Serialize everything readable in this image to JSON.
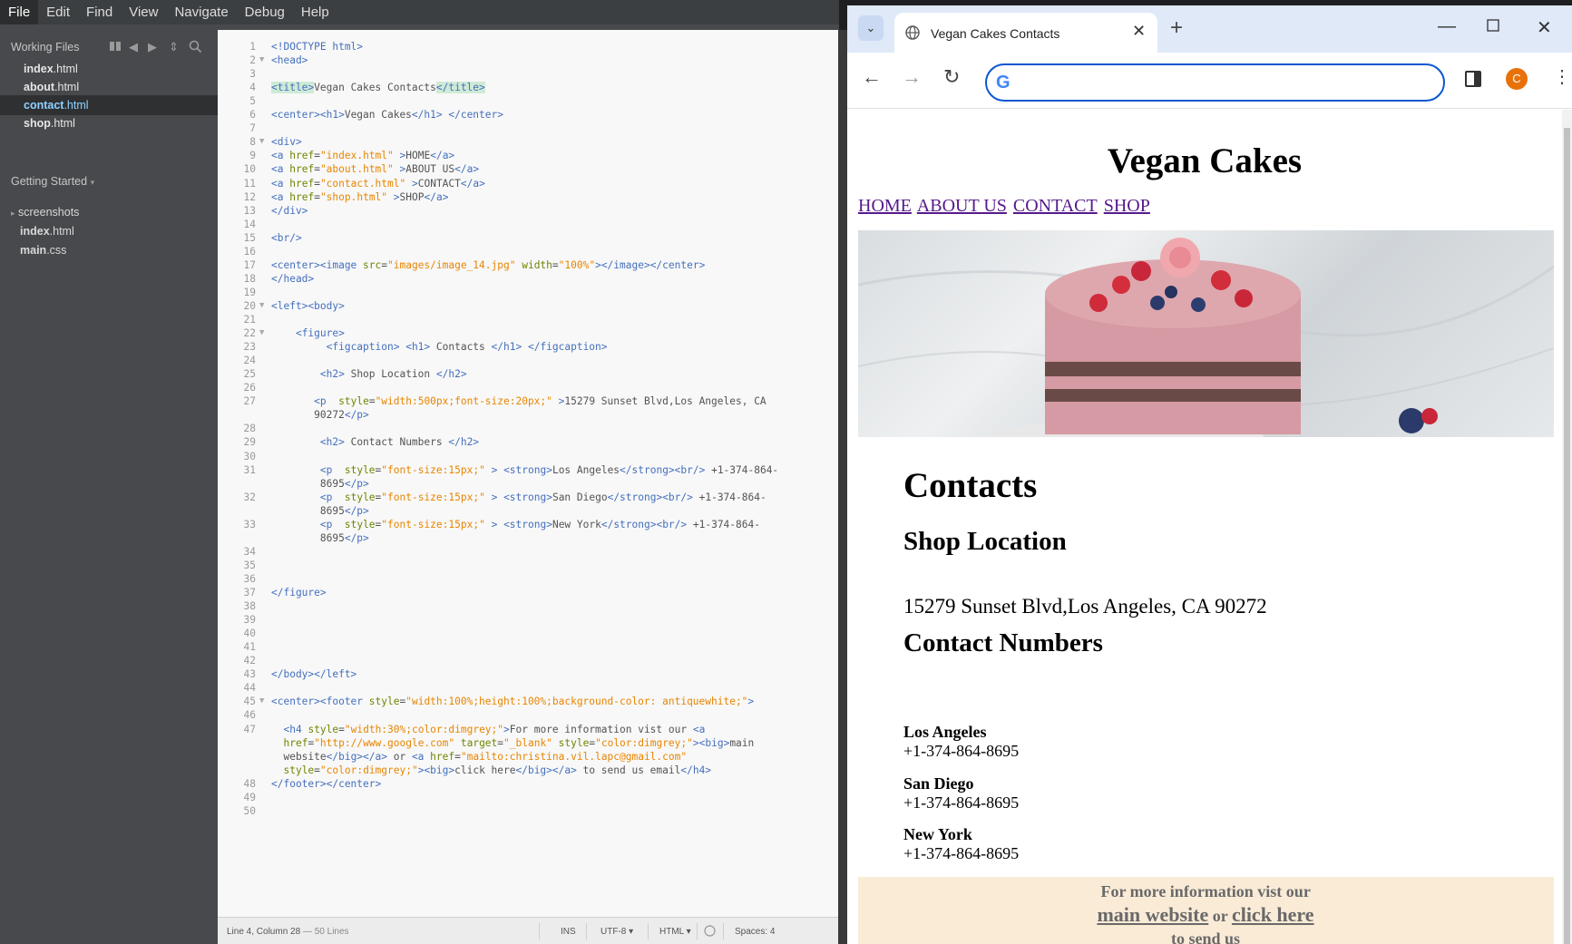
{
  "menubar": [
    "File",
    "Edit",
    "Find",
    "View",
    "Navigate",
    "Debug",
    "Help"
  ],
  "sidebar": {
    "working_files_title": "Working Files",
    "working_files": [
      {
        "name": "index",
        "ext": ".html"
      },
      {
        "name": "about",
        "ext": ".html"
      },
      {
        "name": "contact",
        "ext": ".html"
      },
      {
        "name": "shop",
        "ext": ".html"
      }
    ],
    "getting_started": "Getting Started",
    "tree": [
      {
        "label": "screenshots",
        "type": "folder"
      },
      {
        "name": "index",
        "ext": ".html",
        "type": "file"
      },
      {
        "name": "main",
        "ext": ".css",
        "type": "file"
      }
    ]
  },
  "code_lines": [
    {
      "n": "1",
      "html": "<span class=\"t\">&lt;!DOCTYPE html&gt;</span>"
    },
    {
      "n": "2",
      "fold": true,
      "html": "<span class=\"t\">&lt;head&gt;</span>"
    },
    {
      "n": "3",
      "html": ""
    },
    {
      "n": "4",
      "html": "<span class=\"t hl\">&lt;title&gt;</span>Vegan Cakes Contacts<span class=\"t hl\">&lt;/title&gt;</span>"
    },
    {
      "n": "5",
      "html": ""
    },
    {
      "n": "6",
      "html": "<span class=\"t\">&lt;center&gt;&lt;h1&gt;</span>Vegan Cakes<span class=\"t\">&lt;/h1&gt;</span> <span class=\"t\">&lt;/center&gt;</span>"
    },
    {
      "n": "7",
      "html": ""
    },
    {
      "n": "8",
      "fold": true,
      "html": "<span class=\"t\">&lt;div&gt;</span>"
    },
    {
      "n": "9",
      "html": "<span class=\"t\">&lt;a</span> <span class=\"a\">href</span>=<span class=\"s\">\"index.html\"</span> <span class=\"t\">&gt;</span>HOME<span class=\"t\">&lt;/a&gt;</span>"
    },
    {
      "n": "10",
      "html": "<span class=\"t\">&lt;a</span> <span class=\"a\">href</span>=<span class=\"s\">\"about.html\"</span> <span class=\"t\">&gt;</span>ABOUT US<span class=\"t\">&lt;/a&gt;</span>"
    },
    {
      "n": "11",
      "html": "<span class=\"t\">&lt;a</span> <span class=\"a\">href</span>=<span class=\"s\">\"contact.html\"</span> <span class=\"t\">&gt;</span>CONTACT<span class=\"t\">&lt;/a&gt;</span>"
    },
    {
      "n": "12",
      "html": "<span class=\"t\">&lt;a</span> <span class=\"a\">href</span>=<span class=\"s\">\"shop.html\"</span> <span class=\"t\">&gt;</span>SHOP<span class=\"t\">&lt;/a&gt;</span>"
    },
    {
      "n": "13",
      "html": "<span class=\"t\">&lt;/div&gt;</span>"
    },
    {
      "n": "14",
      "html": ""
    },
    {
      "n": "15",
      "html": "<span class=\"t\">&lt;br/&gt;</span>"
    },
    {
      "n": "16",
      "html": ""
    },
    {
      "n": "17",
      "html": "<span class=\"t\">&lt;center&gt;&lt;image</span> <span class=\"a\">src</span>=<span class=\"s\">\"images/image_14.jpg\"</span> <span class=\"a\">width</span>=<span class=\"s\">\"100%\"</span><span class=\"t\">&gt;&lt;/image&gt;&lt;/center&gt;</span>"
    },
    {
      "n": "18",
      "html": "<span class=\"t\">&lt;/head&gt;</span>"
    },
    {
      "n": "19",
      "html": ""
    },
    {
      "n": "20",
      "fold": true,
      "html": "<span class=\"t\">&lt;left&gt;&lt;body&gt;</span>"
    },
    {
      "n": "21",
      "html": ""
    },
    {
      "n": "22",
      "fold": true,
      "html": "    <span class=\"t\">&lt;figure&gt;</span>"
    },
    {
      "n": "23",
      "html": "         <span class=\"t\">&lt;figcaption&gt;</span> <span class=\"t\">&lt;h1&gt;</span> Contacts <span class=\"t\">&lt;/h1&gt;</span> <span class=\"t\">&lt;/figcaption&gt;</span>"
    },
    {
      "n": "24",
      "html": ""
    },
    {
      "n": "25",
      "html": "        <span class=\"t\">&lt;h2&gt;</span> Shop Location <span class=\"t\">&lt;/h2&gt;</span>"
    },
    {
      "n": "26",
      "html": ""
    },
    {
      "n": "27",
      "html": "       <span class=\"t\">&lt;p</span>  <span class=\"a\">style</span>=<span class=\"s\">\"width:500px;font-size:20px;\"</span> <span class=\"t\">&gt;</span>15279 Sunset Blvd,Los Angeles, CA"
    },
    {
      "n": "",
      "html": "       90272<span class=\"t\">&lt;/p&gt;</span>"
    },
    {
      "n": "28",
      "html": ""
    },
    {
      "n": "29",
      "html": "        <span class=\"t\">&lt;h2&gt;</span> Contact Numbers <span class=\"t\">&lt;/h2&gt;</span>"
    },
    {
      "n": "30",
      "html": ""
    },
    {
      "n": "31",
      "html": "        <span class=\"t\">&lt;p</span>  <span class=\"a\">style</span>=<span class=\"s\">\"font-size:15px;\"</span> <span class=\"t\">&gt;</span> <span class=\"t\">&lt;strong&gt;</span>Los Angeles<span class=\"t\">&lt;/strong&gt;&lt;br/&gt;</span> +1-374-864-"
    },
    {
      "n": "",
      "html": "        8695<span class=\"t\">&lt;/p&gt;</span>"
    },
    {
      "n": "32",
      "html": "        <span class=\"t\">&lt;p</span>  <span class=\"a\">style</span>=<span class=\"s\">\"font-size:15px;\"</span> <span class=\"t\">&gt;</span> <span class=\"t\">&lt;strong&gt;</span>San Diego<span class=\"t\">&lt;/strong&gt;&lt;br/&gt;</span> +1-374-864-"
    },
    {
      "n": "",
      "html": "        8695<span class=\"t\">&lt;/p&gt;</span>"
    },
    {
      "n": "33",
      "html": "        <span class=\"t\">&lt;p</span>  <span class=\"a\">style</span>=<span class=\"s\">\"font-size:15px;\"</span> <span class=\"t\">&gt;</span> <span class=\"t\">&lt;strong&gt;</span>New York<span class=\"t\">&lt;/strong&gt;&lt;br/&gt;</span> +1-374-864-"
    },
    {
      "n": "",
      "html": "        8695<span class=\"t\">&lt;/p&gt;</span>"
    },
    {
      "n": "34",
      "html": ""
    },
    {
      "n": "35",
      "html": ""
    },
    {
      "n": "36",
      "html": ""
    },
    {
      "n": "37",
      "html": "<span class=\"t\">&lt;/figure&gt;</span>"
    },
    {
      "n": "38",
      "html": ""
    },
    {
      "n": "39",
      "html": ""
    },
    {
      "n": "40",
      "html": ""
    },
    {
      "n": "41",
      "html": ""
    },
    {
      "n": "42",
      "html": ""
    },
    {
      "n": "43",
      "html": "<span class=\"t\">&lt;/body&gt;&lt;/left&gt;</span>"
    },
    {
      "n": "44",
      "html": ""
    },
    {
      "n": "45",
      "fold": true,
      "html": "<span class=\"t\">&lt;center&gt;&lt;footer</span> <span class=\"a\">style</span>=<span class=\"s\">\"width:100%;height:100%;background-color: antiquewhite;\"</span><span class=\"t\">&gt;</span>"
    },
    {
      "n": "46",
      "html": ""
    },
    {
      "n": "47",
      "html": "  <span class=\"t\">&lt;h4</span> <span class=\"a\">style</span>=<span class=\"s\">\"width:30%;color:dimgrey;\"</span><span class=\"t\">&gt;</span>For more information vist our <span class=\"t\">&lt;a</span>"
    },
    {
      "n": "",
      "html": "  <span class=\"a\">href</span>=<span class=\"s\">\"http://www.google.com\"</span> <span class=\"a\">target</span>=<span class=\"s\">\"_blank\"</span> <span class=\"a\">style</span>=<span class=\"s\">\"color:dimgrey;\"</span><span class=\"t\">&gt;&lt;big&gt;</span>main"
    },
    {
      "n": "",
      "html": "  website<span class=\"t\">&lt;/big&gt;&lt;/a&gt;</span> or <span class=\"t\">&lt;a</span> <span class=\"a\">href</span>=<span class=\"s\">\"mailto:christina.vil.lapc@gmail.com\"</span>"
    },
    {
      "n": "",
      "html": "  <span class=\"a\">style</span>=<span class=\"s\">\"color:dimgrey;\"</span><span class=\"t\">&gt;&lt;big&gt;</span>click here<span class=\"t\">&lt;/big&gt;&lt;/a&gt;</span> to send us email<span class=\"t\">&lt;/h4&gt;</span>"
    },
    {
      "n": "48",
      "html": "<span class=\"t\">&lt;/footer&gt;&lt;/center&gt;</span>"
    },
    {
      "n": "49",
      "html": ""
    },
    {
      "n": "50",
      "html": ""
    }
  ],
  "statusbar": {
    "cursor": "Line 4, Column 28",
    "lines": "— 50 Lines",
    "mode": "INS",
    "encoding": "UTF-8",
    "language": "HTML",
    "spaces": "Spaces: 4"
  },
  "browser": {
    "tab_title": "Vegan Cakes Contacts",
    "avatar_letter": "C",
    "url_value": "",
    "google_letter": "G"
  },
  "webpage": {
    "title": "Vegan Cakes",
    "nav": [
      "HOME",
      "ABOUT US",
      "CONTACT",
      "SHOP"
    ],
    "contacts_heading": "Contacts",
    "shop_location_heading": "Shop Location",
    "address": "15279 Sunset Blvd,Los Angeles, CA 90272",
    "contact_numbers_heading": "Contact Numbers",
    "contacts": [
      {
        "city": "Los Angeles",
        "phone": "+1-374-864-8695"
      },
      {
        "city": "San Diego",
        "phone": "+1-374-864-8695"
      },
      {
        "city": "New York",
        "phone": "+1-374-864-8695"
      }
    ],
    "footer": {
      "text1": "For more information vist our",
      "link1": "main website",
      "text2": "or",
      "link2": "click here",
      "text3": "to send us"
    }
  }
}
